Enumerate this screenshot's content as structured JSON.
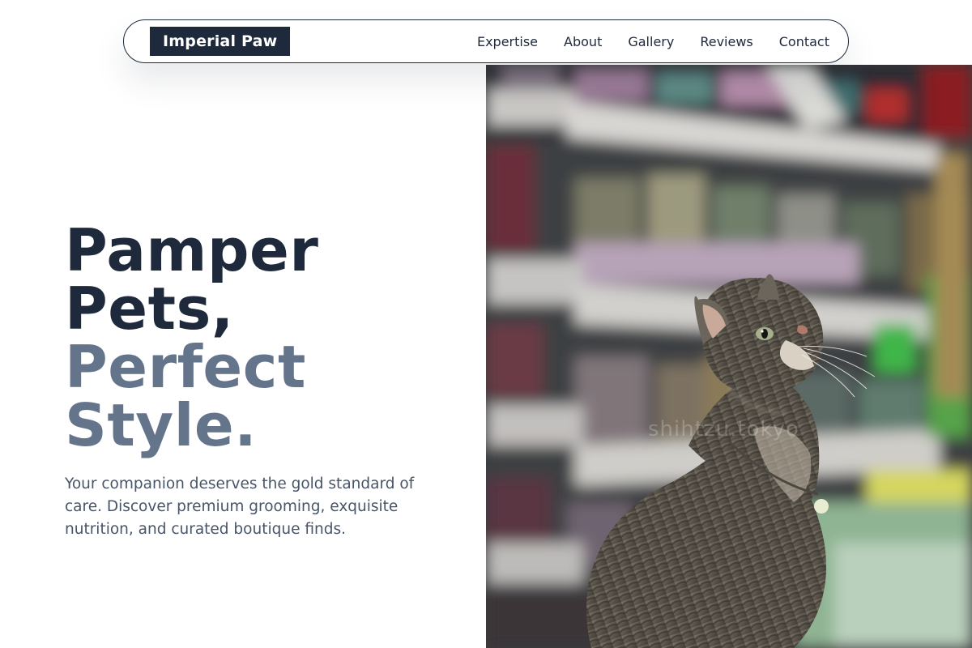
{
  "nav": {
    "brand": "Imperial Paw",
    "links": [
      "Expertise",
      "About",
      "Gallery",
      "Reviews",
      "Contact"
    ]
  },
  "hero": {
    "headline_line1": "Pamper",
    "headline_line2": "Pets,",
    "headline_line3": "Perfect",
    "headline_line4": "Style.",
    "subtext": "Your companion deserves the gold standard of care. Discover premium grooming, exquisite nutrition, and curated boutique finds.",
    "image_watermark": "shihtzu.tokyo"
  },
  "colors": {
    "primary": "#1e293b",
    "accent_muted": "#64748b",
    "body_text": "#475569",
    "background": "#ffffff"
  }
}
